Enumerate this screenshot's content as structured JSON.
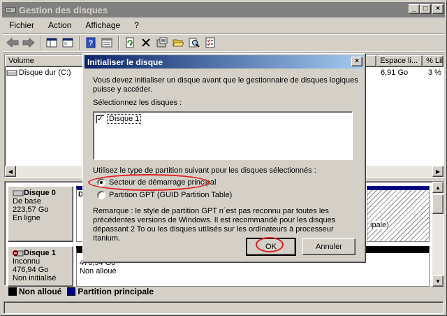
{
  "window": {
    "title": "Gestion des disques",
    "btn_min": "_",
    "btn_max": "□",
    "btn_close": "×"
  },
  "menu": [
    "Fichier",
    "Action",
    "Affichage",
    "?"
  ],
  "volume_list": {
    "columns": [
      "Volume",
      "Espace li...",
      "% Lib"
    ],
    "rows": [
      {
        "name": "Disque dur (C:)",
        "free": "6,91 Go",
        "pct": "3 %"
      }
    ]
  },
  "disks": [
    {
      "name": "Disque 0",
      "type": "De base",
      "size": "223,57 Go",
      "status": "En ligne",
      "partition_tail": "ipale)"
    },
    {
      "name": "Disque 1",
      "type": "Inconnu",
      "size": "476,94 Go",
      "status": "Non initialisé",
      "region_size": "476,94 Go",
      "region_status": "Non alloué"
    }
  ],
  "legend": {
    "unallocated": "Non alloué",
    "primary": "Partition principale",
    "colors": {
      "unallocated": "#000000",
      "primary": "#000080"
    }
  },
  "dialog": {
    "title": "Initialiser le disque",
    "intro": [
      "Vous devez initialiser un disque avant que le gestionnaire de disques logiques",
      "puisse y accéder."
    ],
    "select_label": "Sélectionnez les disques :",
    "disk_items": [
      {
        "label": "Disque 1",
        "checked": true
      }
    ],
    "partition_label": "Utilisez le type de partition suivant pour les disques sélectionnés :",
    "options": [
      {
        "label": "Secteur de démarrage principal",
        "selected": true
      },
      {
        "label": "Partition GPT (GUID Partition Table)",
        "selected": false
      }
    ],
    "remark": [
      "Remarque : le style de partition GPT n´est pas reconnu par toutes les",
      "précédentes versions de Windows. Il est recommandé pour les disques",
      "dépassant 2 To ou les disques utilisés sur les ordinateurs à processeur Itanium."
    ],
    "ok": "OK",
    "cancel": "Annuler",
    "close": "×"
  },
  "annotation_color": "#e31e24"
}
